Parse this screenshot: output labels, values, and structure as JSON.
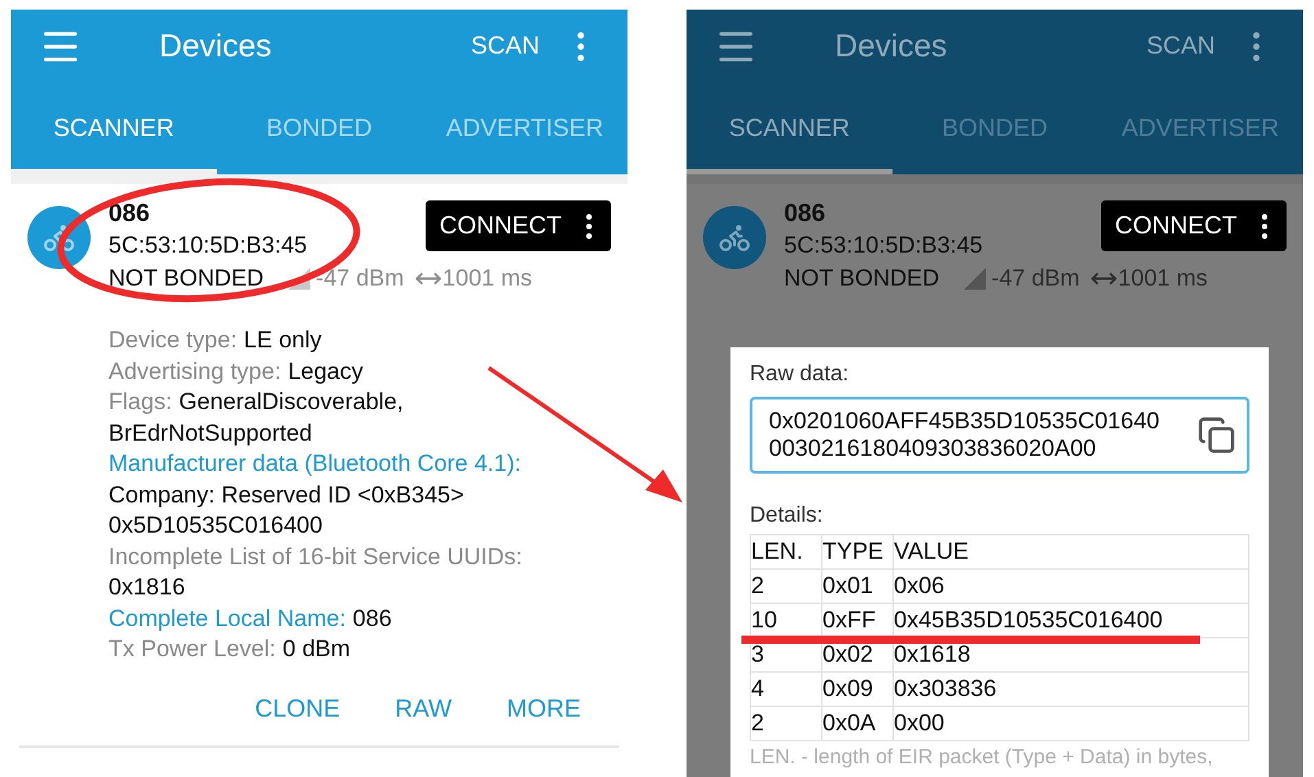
{
  "left_screen": {
    "dimmed": false,
    "app_bar": {
      "title": "Devices",
      "action": "SCAN"
    },
    "tabs": [
      {
        "label": "SCANNER",
        "selected": true
      },
      {
        "label": "BONDED",
        "selected": false
      },
      {
        "label": "ADVERTISER",
        "selected": false
      }
    ],
    "device": {
      "name": "086",
      "address": "5C:53:10:5D:B3:45",
      "bond_state": "NOT BONDED",
      "rssi": "-47 dBm",
      "interval": "1001 ms",
      "connect": "CONNECT",
      "details": [
        {
          "label": "Device type:",
          "highlighted": false,
          "value_on_new_line": false,
          "lines": [
            "LE only"
          ]
        },
        {
          "label": "Advertising type:",
          "highlighted": false,
          "value_on_new_line": false,
          "lines": [
            "Legacy"
          ]
        },
        {
          "label": "Flags:",
          "highlighted": false,
          "value_on_new_line": false,
          "lines": [
            "GeneralDiscoverable,",
            "BrEdrNotSupported"
          ]
        },
        {
          "label": "Manufacturer data (Bluetooth Core 4.1):",
          "highlighted": true,
          "value_on_new_line": true,
          "lines": [
            "Company: Reserved ID <0xB345>",
            "0x5D10535C016400"
          ]
        },
        {
          "label": "Incomplete List of 16-bit Service UUIDs:",
          "highlighted": false,
          "value_on_new_line": true,
          "lines": [
            "0x1816"
          ]
        },
        {
          "label": "Complete Local Name:",
          "highlighted": true,
          "value_on_new_line": false,
          "lines": [
            "086"
          ]
        },
        {
          "label": "Tx Power Level:",
          "highlighted": false,
          "value_on_new_line": false,
          "lines": [
            "0 dBm"
          ]
        }
      ],
      "actions": [
        "CLONE",
        "RAW",
        "MORE"
      ]
    }
  },
  "right_screen": {
    "dimmed": true,
    "app_bar": {
      "title": "Devices",
      "action": "SCAN"
    },
    "tabs": [
      {
        "label": "SCANNER",
        "selected": true
      },
      {
        "label": "BONDED",
        "selected": false
      },
      {
        "label": "ADVERTISER",
        "selected": false
      }
    ],
    "device": {
      "name": "086",
      "address": "5C:53:10:5D:B3:45",
      "bond_state": "NOT BONDED",
      "rssi": "-47 dBm",
      "interval": "1001 ms",
      "connect": "CONNECT"
    },
    "dialog": {
      "raw_label": "Raw data:",
      "raw_lines": [
        "0x0201060AFF45B35D10535C01640",
        "0030216180409303836020A00"
      ],
      "details_label": "Details:",
      "columns": [
        "LEN.",
        "TYPE",
        "VALUE"
      ],
      "rows": [
        [
          "2",
          "0x01",
          "0x06"
        ],
        [
          "10",
          "0xFF",
          "0x45B35D10535C016400"
        ],
        [
          "3",
          "0x02",
          "0x1618"
        ],
        [
          "4",
          "0x09",
          "0x303836"
        ],
        [
          "2",
          "0x0A",
          "0x00"
        ]
      ],
      "footnote": "LEN. - length of EIR packet (Type + Data) in bytes,"
    }
  }
}
